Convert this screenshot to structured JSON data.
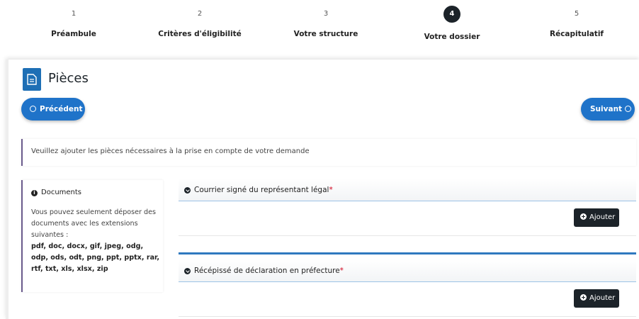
{
  "stepper": {
    "steps": [
      {
        "number": "1",
        "label": "Préambule"
      },
      {
        "number": "2",
        "label": "Critères d'éligibilité"
      },
      {
        "number": "3",
        "label": "Votre structure"
      },
      {
        "number": "4",
        "label": "Votre dossier",
        "active": true
      },
      {
        "number": "5",
        "label": "Récapitulatif"
      }
    ]
  },
  "page": {
    "title": "Pièces",
    "title_icon": "document-icon"
  },
  "nav": {
    "prev_label": "Précédent",
    "next_label": "Suivant"
  },
  "info": {
    "text": "Veuillez ajouter les pièces nécessaires à la prise en compte de votre demande"
  },
  "documents": {
    "title": "Documents",
    "description": "Vous pouvez seulement déposer des documents avec les extensions suivantes :",
    "extensions": "pdf, doc, docx, gif, jpeg, odg, odp, ods, odt, png, ppt, pptx, rar, rtf, txt, xls, xlsx, zip"
  },
  "sections": [
    {
      "title": "Courrier signé du représentant légal",
      "required_mark": "*",
      "add_label": "Ajouter"
    },
    {
      "title": "Récépissé de déclaration en préfecture",
      "required_mark": "*",
      "add_label": "Ajouter"
    }
  ],
  "colors": {
    "accent": "#1f73c9",
    "dark": "#1c2329",
    "required": "#d0021b"
  }
}
